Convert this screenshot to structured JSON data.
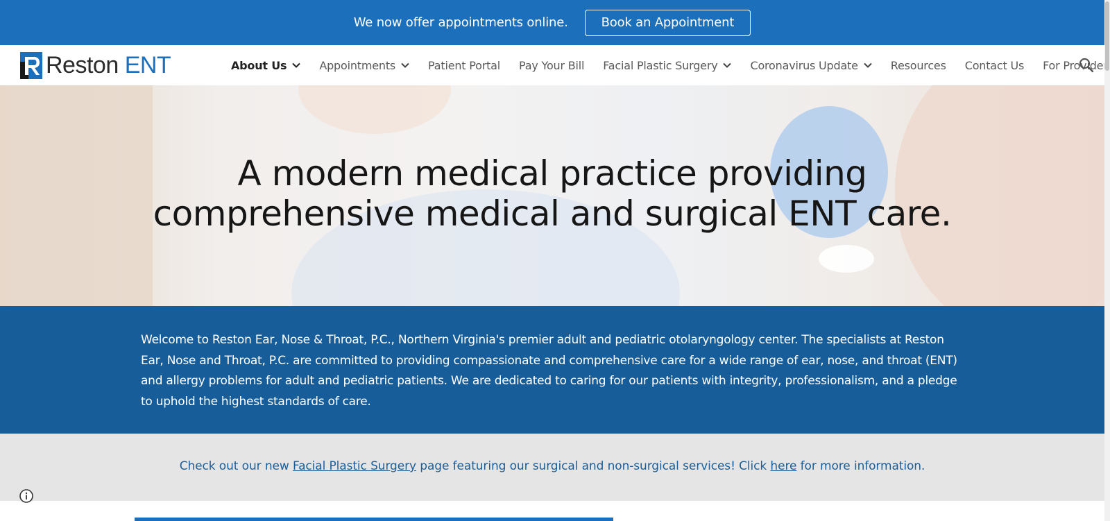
{
  "promo": {
    "text": "We now offer appointments online.",
    "button_label": "Book an Appointment"
  },
  "brand": {
    "name_part1": "Reston",
    "name_part2": "ENT"
  },
  "nav": {
    "items": [
      {
        "label": "About Us",
        "has_dropdown": true,
        "active": true
      },
      {
        "label": "Appointments",
        "has_dropdown": true
      },
      {
        "label": "Patient Portal"
      },
      {
        "label": "Pay Your Bill"
      },
      {
        "label": "Facial Plastic Surgery",
        "has_dropdown": true
      },
      {
        "label": "Coronavirus Update",
        "has_dropdown": true
      },
      {
        "label": "Resources"
      },
      {
        "label": "Contact Us"
      },
      {
        "label": "For Providers"
      }
    ],
    "search_icon": "search-icon"
  },
  "hero": {
    "line1": "A modern medical practice providing",
    "line2": "comprehensive medical and surgical ENT care."
  },
  "welcome": {
    "text": "Welcome to Reston Ear, Nose & Throat, P.C., Northern Virginia's premier adult and pediatric otolaryngology center. The specialists at Reston Ear, Nose and Throat, P.C. are committed to providing compassionate and comprehensive care for a wide range of ear, nose, and throat (ENT) and allergy problems for adult and pediatric patients. We are dedicated to caring for our patients with integrity, professionalism, and a pledge to uphold the highest standards of care."
  },
  "notice": {
    "prefix": "Check out our new ",
    "link1": "Facial Plastic Surgery",
    "middle": " page featuring our surgical and non-surgical services! Click ",
    "link2": "here",
    "suffix": " for more information."
  },
  "colors": {
    "brand_blue": "#1c6fbb",
    "section_blue": "#175d9a",
    "notice_gray": "#e5e5e5"
  }
}
